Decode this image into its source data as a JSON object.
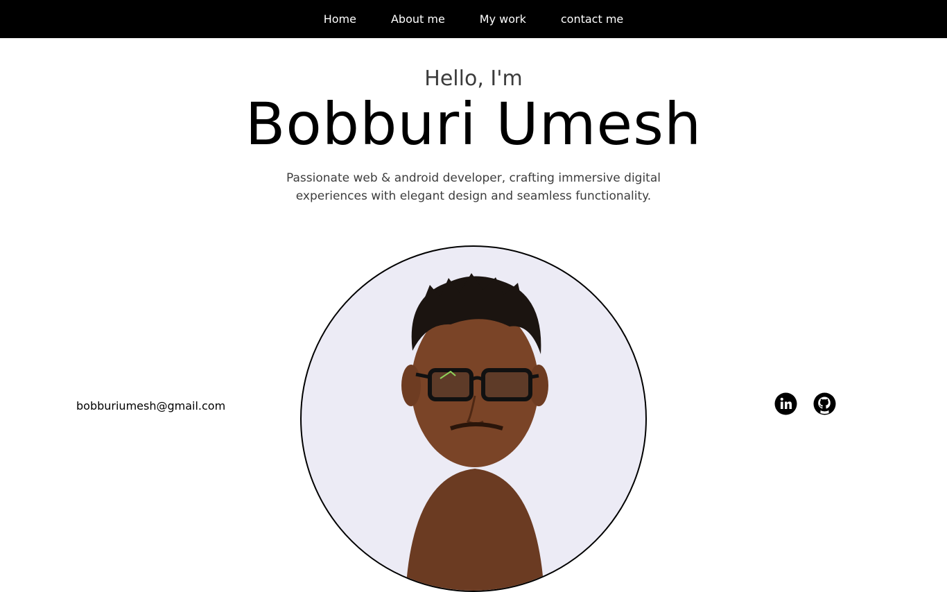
{
  "nav": {
    "items": [
      {
        "label": "Home"
      },
      {
        "label": "About me"
      },
      {
        "label": "My work"
      },
      {
        "label": "contact me"
      }
    ]
  },
  "hero": {
    "greeting": "Hello, I'm",
    "name": "Bobburi Umesh",
    "tagline": "Passionate web & android developer, crafting immersive digital experiences with elegant design and seamless functionality."
  },
  "contact": {
    "email": "bobburiumesh@gmail.com"
  },
  "socials": [
    {
      "icon": "linkedin-icon"
    },
    {
      "icon": "github-icon"
    }
  ],
  "colors": {
    "nav_bg": "#000000",
    "nav_text": "#ffffff",
    "portrait_bg": "#ecebf5",
    "subtle_text": "#3d3d3d"
  }
}
